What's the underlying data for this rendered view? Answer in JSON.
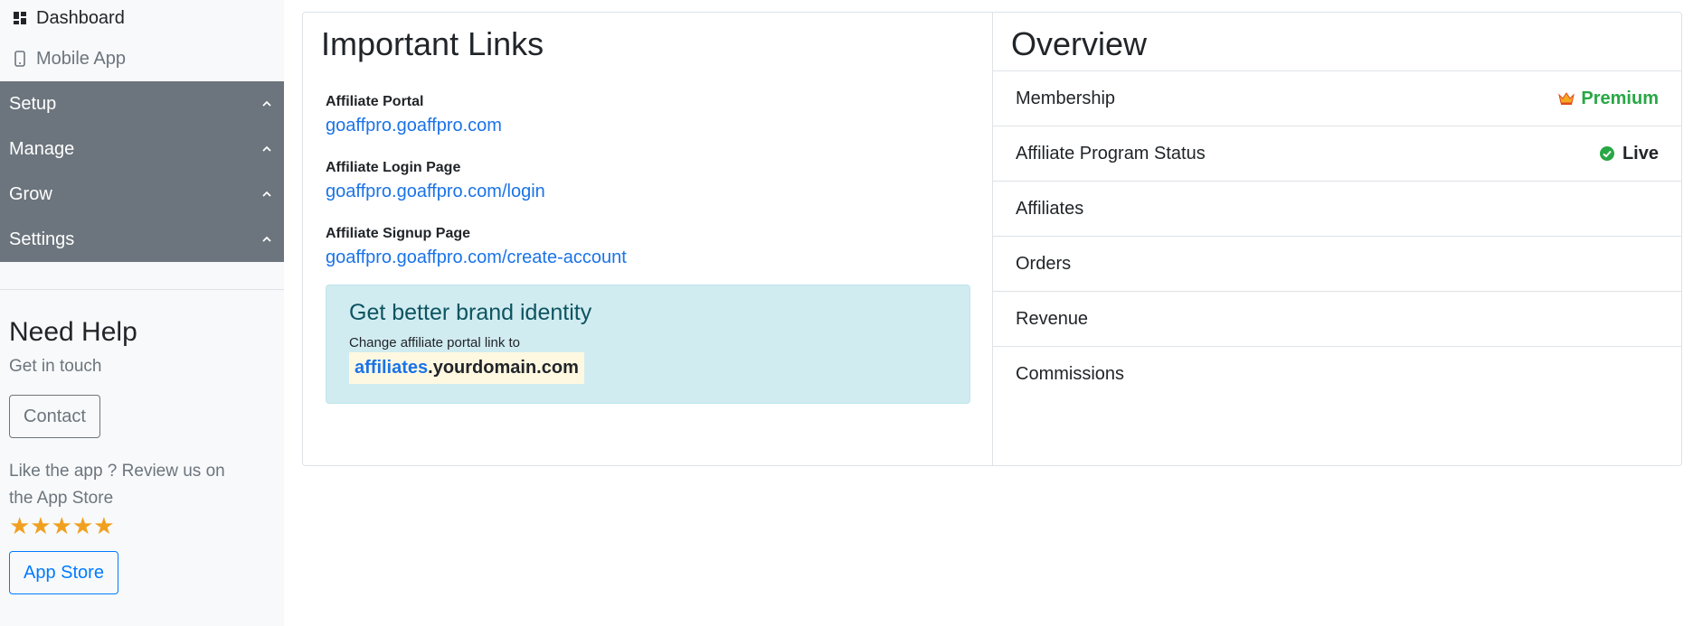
{
  "sidebar": {
    "dashboard_label": "Dashboard",
    "mobile_label": "Mobile App",
    "groups": [
      {
        "label": "Setup"
      },
      {
        "label": "Manage"
      },
      {
        "label": "Grow"
      },
      {
        "label": "Settings"
      }
    ],
    "help": {
      "title": "Need Help",
      "subtitle": "Get in touch",
      "contact_label": "Contact",
      "review_text": "Like the app ? Review us on the App Store",
      "stars": "★★★★★",
      "app_store_label": "App Store"
    }
  },
  "links": {
    "title": "Important Links",
    "items": [
      {
        "label": "Affiliate Portal",
        "url": "goaffpro.goaffpro.com"
      },
      {
        "label": "Affiliate Login Page",
        "url": "goaffpro.goaffpro.com/login"
      },
      {
        "label": "Affiliate Signup Page",
        "url": "goaffpro.goaffpro.com/create-account"
      }
    ],
    "promo": {
      "title": "Get better brand identity",
      "text": "Change affiliate portal link to",
      "domain_sub": "affiliates",
      "domain_rest": ".yourdomain.com"
    }
  },
  "overview": {
    "title": "Overview",
    "rows": [
      {
        "label": "Membership",
        "value": "Premium"
      },
      {
        "label": "Affiliate Program Status",
        "value": "Live"
      },
      {
        "label": "Affiliates",
        "value": ""
      },
      {
        "label": "Orders",
        "value": ""
      },
      {
        "label": "Revenue",
        "value": ""
      },
      {
        "label": "Commissions",
        "value": ""
      }
    ]
  },
  "colors": {
    "sidebar_group_bg": "#6c757d",
    "link": "#1a73e8",
    "premium": "#28a745",
    "star": "#f0a020",
    "info_bg": "#d1ecf1"
  }
}
